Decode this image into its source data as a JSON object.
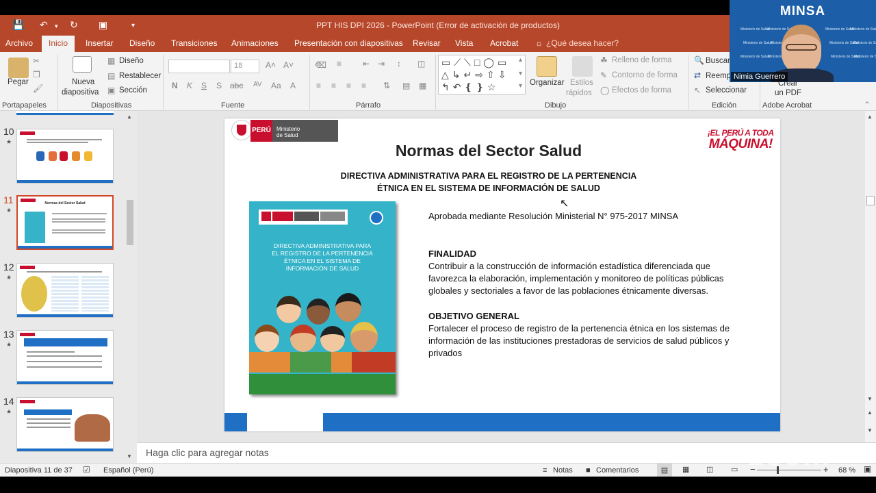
{
  "window": {
    "title": "PPT HIS DPI 2026 - PowerPoint (Error de activación de productos)"
  },
  "tabs": [
    "Archivo",
    "Inicio",
    "Insertar",
    "Diseño",
    "Transiciones",
    "Animaciones",
    "Presentación con diapositivas",
    "Revisar",
    "Vista",
    "Acrobat"
  ],
  "tell_me": "¿Qué desea hacer?",
  "ribbon": {
    "clipboard": {
      "paste": "Pegar",
      "label": "Portapapeles"
    },
    "slides": {
      "new_slide_1": "Nueva",
      "new_slide_2": "diapositiva",
      "layout": "Diseño",
      "reset": "Restablecer",
      "section": "Sección",
      "label": "Diapositivas"
    },
    "font": {
      "size": "18",
      "label": "Fuente",
      "bold": "N",
      "italic": "K",
      "underline": "S",
      "strike": "S",
      "shadow": "abc",
      "spacing": "AV",
      "case": "Aa",
      "color": "A"
    },
    "paragraph": {
      "label": "Párrafo"
    },
    "drawing": {
      "arrange": "Organizar",
      "styles_1": "Estilos",
      "styles_2": "rápidos",
      "fill": "Relleno de forma",
      "outline": "Contorno de forma",
      "effects": "Efectos de forma",
      "label": "Dibujo"
    },
    "editing": {
      "find": "Buscar",
      "replace": "Reemp",
      "select": "Seleccionar",
      "label": "Edición"
    },
    "acrobat": {
      "create_1": "Crear",
      "create_2": "un PDF",
      "label": "Adobe Acrobat"
    }
  },
  "thumbnails": [
    {
      "number": "10",
      "star": "★"
    },
    {
      "number": "11",
      "star": "★",
      "title": "Normas del Sector Salud"
    },
    {
      "number": "12",
      "star": "★"
    },
    {
      "number": "13",
      "star": "★"
    },
    {
      "number": "14",
      "star": "★"
    }
  ],
  "slide": {
    "logo_peru": "PERÚ",
    "logo_ministry_1": "Ministerio",
    "logo_ministry_2": "de Salud",
    "slogan_1": "¡EL PERÚ A TODA",
    "slogan_2": "MÁQUINA!",
    "title": "Normas del Sector Salud",
    "subtitle_1": "DIRECTIVA ADMINISTRATIVA PARA EL REGISTRO DE LA PERTENENCIA",
    "subtitle_2": "ÉTNICA EN EL SISTEMA DE INFORMACIÓN DE SALUD",
    "cover_title_1": "DIRECTIVA ADMINISTRATIVA PARA",
    "cover_title_2": "EL REGISTRO DE LA PERTENENCIA",
    "cover_title_3": "ÉTNICA EN EL SISTEMA DE",
    "cover_title_4": "INFORMACIÓN DE SALUD",
    "approved": "Aprobada mediante Resolución Ministerial N° 975-2017 MINSA",
    "finalidad_heading": "FINALIDAD",
    "finalidad_1": "Contribuir a la construcción de información estadística diferenciada que",
    "finalidad_2": "favorezca la elaboración, implementación y monitoreo de políticas públicas",
    "finalidad_3": "globales y sectoriales a favor de las poblaciones étnicamente diversas.",
    "objetivo_heading": "OBJETIVO GENERAL",
    "objetivo_1": "Fortalecer el proceso de registro de la pertenencia étnica en los sistemas de",
    "objetivo_2": "información de las instituciones prestadoras de servicios de salud públicos y",
    "objetivo_3": "privados"
  },
  "notes_placeholder": "Haga clic para agregar notas",
  "status": {
    "slide_count": "Diapositiva 11 de 37",
    "language": "Español (Perú)",
    "notes": "Notas",
    "comments": "Comentarios",
    "zoom": "68 %",
    "zoom_level": 0.68
  },
  "video": {
    "org": "MINSA",
    "watermark": "Ministerio de Salud",
    "participant": "Nimia Guerrero",
    "app": "zoom"
  },
  "colors": {
    "accent": "#b7472a",
    "ribbon": "#f3f3f3",
    "selected_thumb": "#d24726",
    "slide_blue": "#1f6fc4",
    "cover_teal": "#34b3c9"
  }
}
